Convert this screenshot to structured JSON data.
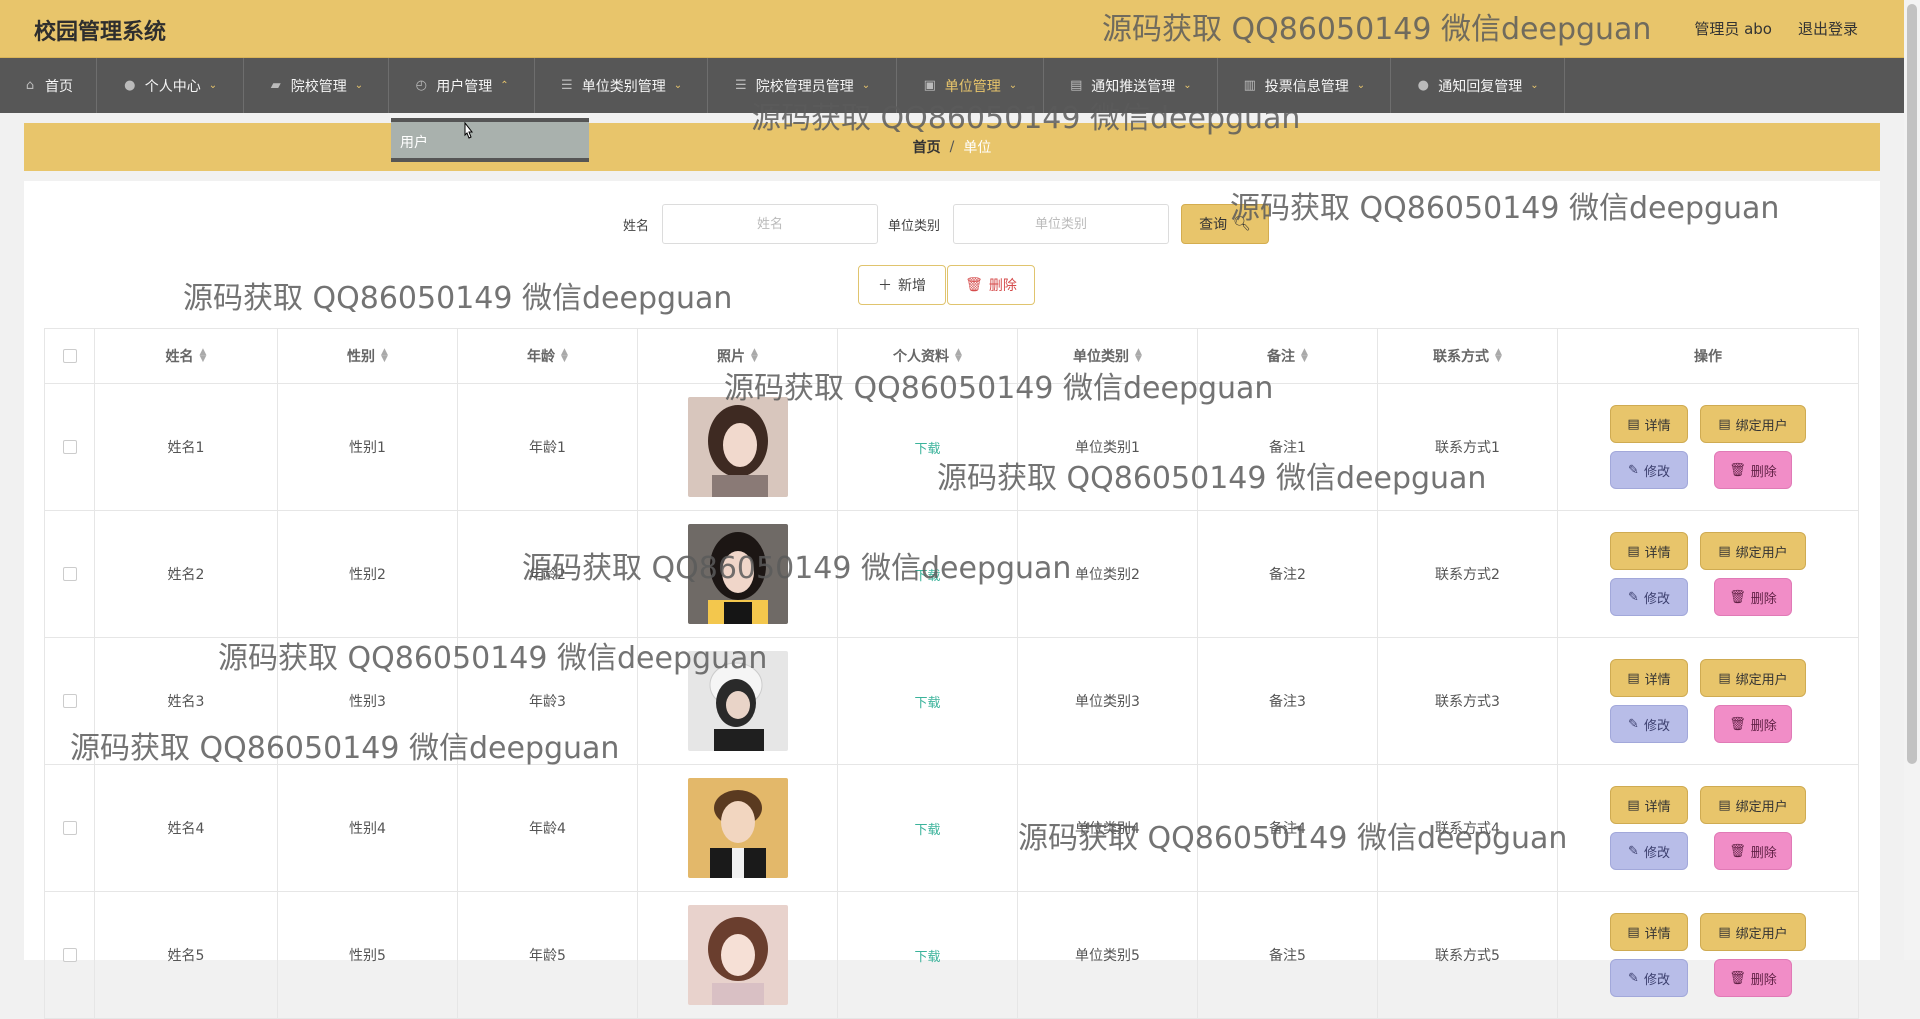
{
  "header": {
    "app_title": "校园管理系统",
    "user_label": "管理员 abo",
    "logout_label": "退出登录"
  },
  "nav": {
    "items": [
      {
        "label": "首页",
        "icon": "home-icon",
        "has_chevron": false,
        "active": false
      },
      {
        "label": "个人中心",
        "icon": "user-icon",
        "has_chevron": true,
        "active": false
      },
      {
        "label": "院校管理",
        "icon": "school-icon",
        "has_chevron": true,
        "active": false
      },
      {
        "label": "用户管理",
        "icon": "gauge-icon",
        "has_chevron": true,
        "active": false,
        "open": true
      },
      {
        "label": "单位类别管理",
        "icon": "list-icon",
        "has_chevron": true,
        "active": false
      },
      {
        "label": "院校管理员管理",
        "icon": "list-icon",
        "has_chevron": true,
        "active": false
      },
      {
        "label": "单位管理",
        "icon": "image-icon",
        "has_chevron": true,
        "active": true
      },
      {
        "label": "通知推送管理",
        "icon": "briefcase-icon",
        "has_chevron": true,
        "active": false
      },
      {
        "label": "投票信息管理",
        "icon": "bar-chart-icon",
        "has_chevron": true,
        "active": false
      },
      {
        "label": "通知回复管理",
        "icon": "user-icon",
        "has_chevron": true,
        "active": false
      }
    ],
    "dropdown_item": "用户"
  },
  "breadcrumb": {
    "home": "首页",
    "separator": "/",
    "current": "单位"
  },
  "search": {
    "name_label": "姓名",
    "name_placeholder": "姓名",
    "category_label": "单位类别",
    "category_placeholder": "单位类别",
    "query_label": "查询"
  },
  "actions": {
    "add_label": "新增",
    "delete_label": "删除"
  },
  "table": {
    "columns": [
      "姓名",
      "性别",
      "年龄",
      "照片",
      "个人资料",
      "单位类别",
      "备注",
      "联系方式",
      "操作"
    ],
    "rows": [
      {
        "name": "姓名1",
        "gender": "性别1",
        "age": "年龄1",
        "file": "下载",
        "category": "单位类别1",
        "note": "备注1",
        "contact": "联系方式1"
      },
      {
        "name": "姓名2",
        "gender": "性别2",
        "age": "年龄2",
        "file": "下载",
        "category": "单位类别2",
        "note": "备注2",
        "contact": "联系方式2"
      },
      {
        "name": "姓名3",
        "gender": "性别3",
        "age": "年龄3",
        "file": "下载",
        "category": "单位类别3",
        "note": "备注3",
        "contact": "联系方式3"
      },
      {
        "name": "姓名4",
        "gender": "性别4",
        "age": "年龄4",
        "file": "下载",
        "category": "单位类别4",
        "note": "备注4",
        "contact": "联系方式4"
      },
      {
        "name": "姓名5",
        "gender": "性别5",
        "age": "年龄5",
        "file": "下载",
        "category": "单位类别5",
        "note": "备注5",
        "contact": "联系方式5"
      }
    ],
    "op_labels": {
      "detail": "详情",
      "bind": "绑定用户",
      "edit": "修改",
      "delete": "删除"
    }
  },
  "watermark": "源码获取 QQ86050149 微信deepguan",
  "colors": {
    "accent": "#e8c56b",
    "nav_bg": "#575757",
    "edit_btn": "#b8bde8",
    "delete_btn": "#f18dc7",
    "link": "#3bb39b"
  }
}
